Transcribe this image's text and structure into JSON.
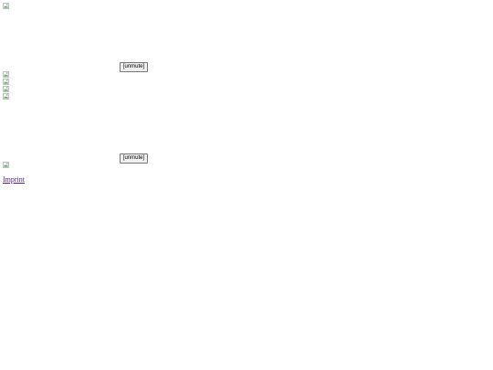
{
  "video_players": [
    {
      "unmute_label": "[unmute]"
    },
    {
      "unmute_label": "[unmute]"
    }
  ],
  "images": [
    {
      "icon": "broken-image-icon"
    },
    {
      "icon": "broken-image-icon"
    },
    {
      "icon": "broken-image-icon"
    },
    {
      "icon": "broken-image-icon"
    },
    {
      "icon": "broken-image-icon"
    },
    {
      "icon": "broken-image-icon"
    }
  ],
  "footer": {
    "imprint_label": "Imprint"
  },
  "colors": {
    "link_visited": "#551a8b",
    "button_bg": "#efefef",
    "button_border": "#767676"
  }
}
